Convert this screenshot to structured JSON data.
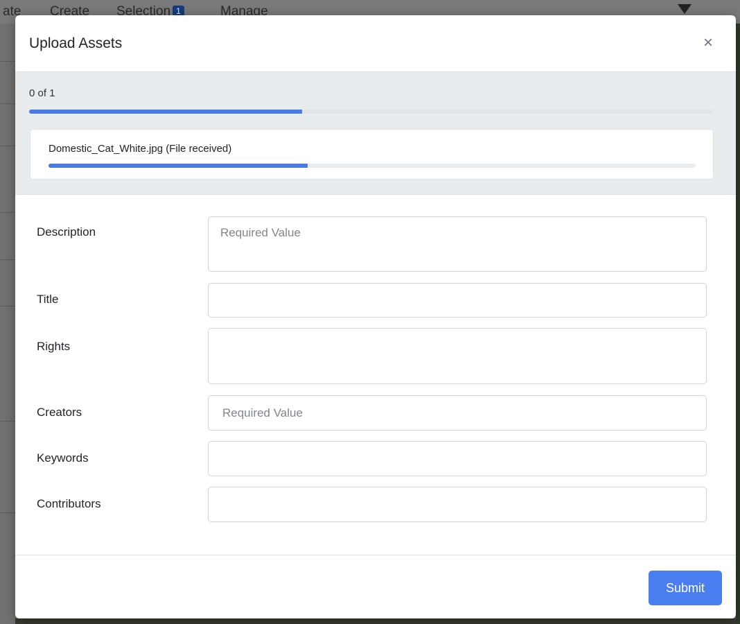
{
  "background": {
    "nav": [
      "ate",
      "Create",
      "Selection",
      "Manage"
    ],
    "selection_badge": "1"
  },
  "modal": {
    "title": "Upload Assets",
    "close_symbol": "×",
    "close_icon": "close-icon"
  },
  "upload": {
    "count_text": "0 of 1",
    "overall_progress": 0.4,
    "file": {
      "label": "Domestic_Cat_White.jpg (File received)",
      "progress": 0.4
    }
  },
  "form": {
    "fields": [
      {
        "label": "Description",
        "placeholder": "Required Value",
        "value": ""
      },
      {
        "label": "Title",
        "placeholder": "",
        "value": ""
      },
      {
        "label": "Rights",
        "placeholder": "",
        "value": ""
      },
      {
        "label": "Creators",
        "placeholder": "Required Value",
        "value": ""
      },
      {
        "label": "Keywords",
        "placeholder": "",
        "value": ""
      },
      {
        "label": "Contributors",
        "placeholder": "",
        "value": ""
      }
    ]
  },
  "footer": {
    "submit_label": "Submit"
  },
  "colors": {
    "accent": "#4a7ef0",
    "progress": "#4a7be5",
    "upload_area_bg": "#e9ecef"
  }
}
